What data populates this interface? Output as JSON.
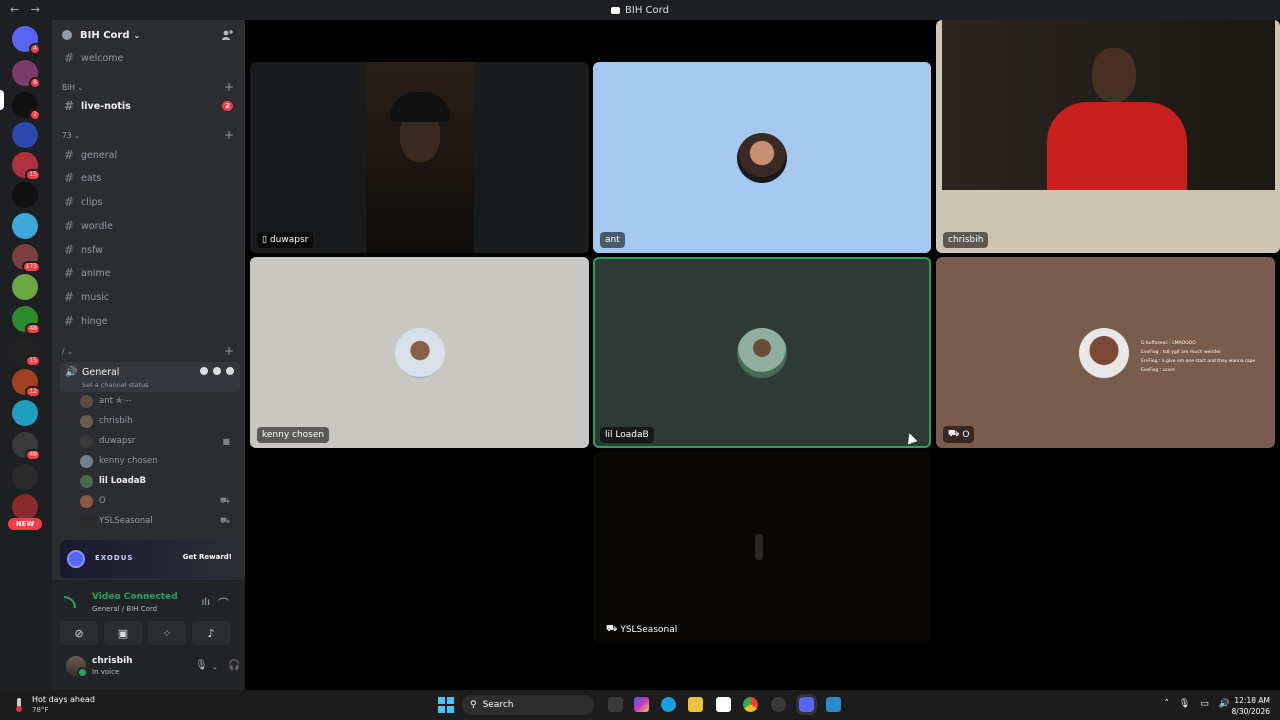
{
  "window": {
    "title": "BIH Cord",
    "back": "←",
    "forward": "→"
  },
  "servers": [
    {
      "badge": "4",
      "color": "#5865f2"
    },
    {
      "badge": "8",
      "color": "#7a3a6a"
    },
    {
      "badge": "2",
      "color": "#101010"
    },
    {
      "badge": "",
      "color": "#2a4ab0"
    },
    {
      "badge": "15",
      "color": "#b03040"
    },
    {
      "badge": "",
      "color": "#111111"
    },
    {
      "badge": "",
      "color": "#3fa8d8"
    },
    {
      "badge": "173",
      "color": "#7a4040"
    },
    {
      "badge": "",
      "color": "#6ba845"
    },
    {
      "badge": "48",
      "color": "#2c8a2c"
    },
    {
      "badge": "15",
      "color": "#222222"
    },
    {
      "badge": "12",
      "color": "#a04020"
    },
    {
      "badge": "",
      "color": "#20a0c0"
    },
    {
      "badge": "49",
      "color": "#3a3a3a"
    },
    {
      "badge": "",
      "color": "#2a2a2a"
    },
    {
      "badge": "",
      "color": "#8a2a2a"
    }
  ],
  "servers_new_label": "NEW",
  "guild": {
    "name": "BIH Cord"
  },
  "channels": {
    "top": [
      {
        "name": "welcome"
      }
    ],
    "cat_bih": "BIH",
    "bih": [
      {
        "name": "live-notis",
        "count": "2"
      }
    ],
    "cat_73": "73",
    "c73": [
      {
        "name": "general"
      },
      {
        "name": "eats"
      },
      {
        "name": "clips"
      },
      {
        "name": "wordle"
      },
      {
        "name": "nsfw"
      },
      {
        "name": "anime"
      },
      {
        "name": "music"
      },
      {
        "name": "hinge"
      }
    ],
    "cat_slash": "/"
  },
  "voice": {
    "channel": "General",
    "status_hint": "Set a channel status",
    "members": [
      {
        "name": "ant",
        "extra": "✯·--",
        "color": "#5a4a40"
      },
      {
        "name": "chrisbih",
        "extra": "",
        "color": "#6a5c50"
      },
      {
        "name": "duwapsr",
        "extra": "",
        "color": "#3a3a3a"
      },
      {
        "name": "kenny chosen",
        "extra": "",
        "color": "#708090"
      },
      {
        "name": "lil LoadaB",
        "extra": "",
        "color": "#4a6a50"
      },
      {
        "name": "O",
        "extra": "",
        "color": "#8a5a40"
      },
      {
        "name": "YSLSeasonal",
        "extra": "",
        "color": "#2a2a2a"
      }
    ]
  },
  "promo": {
    "brand": "EXODUS",
    "cta": "Get Reward!"
  },
  "voice_panel": {
    "status": "Video Connected",
    "location": "General / BIH Cord"
  },
  "user": {
    "name": "chrisbih",
    "status": "In voice"
  },
  "tiles": [
    {
      "name": "duwapsr",
      "bg": "#1a1b1c"
    },
    {
      "name": "ant",
      "bg": "#a4c8ee"
    },
    {
      "name": "chrisbih",
      "bg": "#cdc6b3"
    },
    {
      "name": "kenny chosen",
      "bg": "#c9c7c2"
    },
    {
      "name": "lil LoadaB",
      "bg": "#2d3a36"
    },
    {
      "name": "O",
      "bg": "#7a5c4c"
    },
    {
      "name": "YSLSeasonal",
      "bg": "#0a0806"
    }
  ],
  "overlay_text": [
    "G buffoseec : LMAOOOO",
    "EvoFiog : ts8 ygit are much weirder",
    "ErvFiog : a give em one start and they wanna rape",
    "EvoFiog : score"
  ],
  "taskbar": {
    "weather_title": "Hot days ahead",
    "weather_temp": "78°F",
    "search": "Search",
    "time": "12:18 AM",
    "date": "8/30/2026"
  }
}
